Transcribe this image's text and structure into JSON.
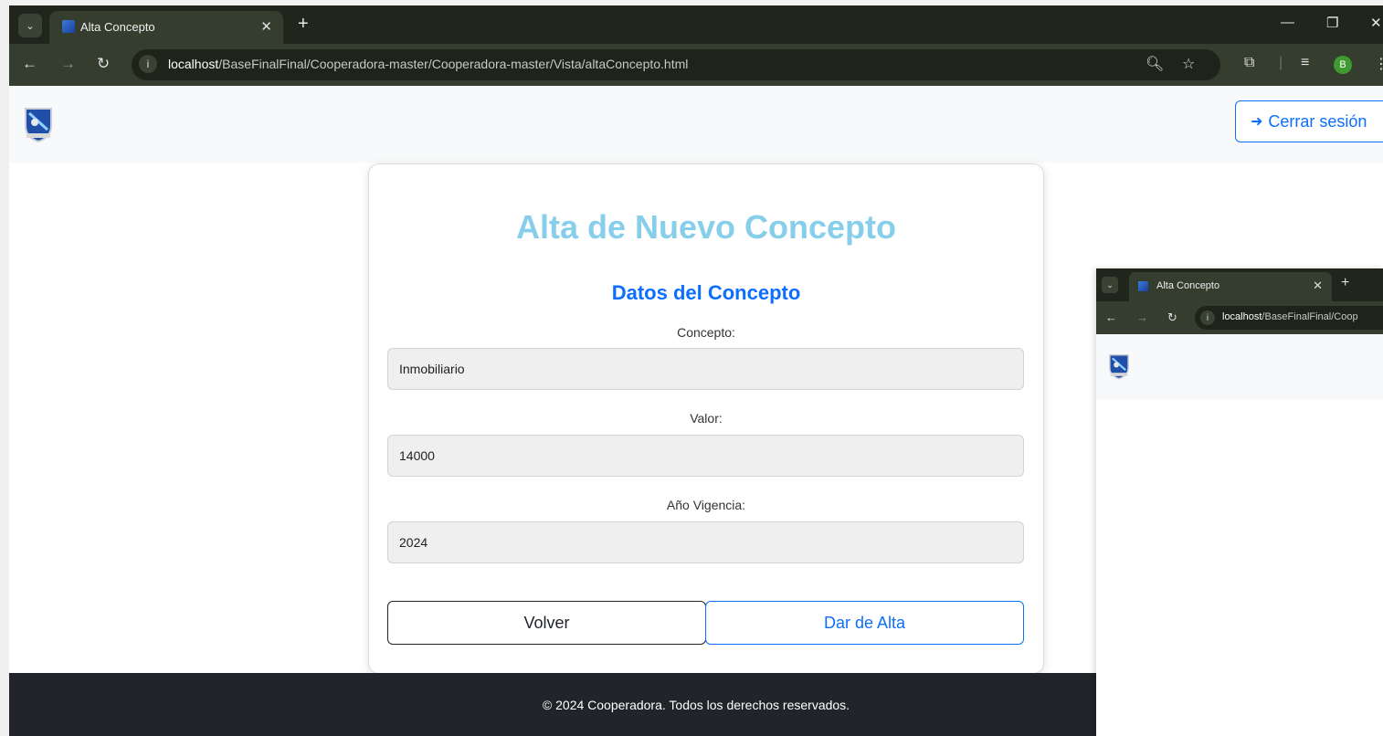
{
  "browser": {
    "tab_title": "Alta Concepto",
    "url_host": "localhost",
    "url_path": "/BaseFinalFinal/Cooperadora-master/Cooperadora-master/Vista/altaConcepto.html",
    "profile_initial": "B"
  },
  "navbar": {
    "logout_label": "Cerrar sesión"
  },
  "form": {
    "title": "Alta de Nuevo Concepto",
    "section_title": "Datos del Concepto",
    "concepto_label": "Concepto:",
    "concepto_value": "Inmobiliario",
    "valor_label": "Valor:",
    "valor_value": "14000",
    "anio_label": "Año Vigencia:",
    "anio_value": "2024",
    "back_label": "Volver",
    "submit_label": "Dar de Alta"
  },
  "footer": {
    "text": "© 2024 Cooperadora. Todos los derechos reservados."
  },
  "thumbnail": {
    "tab_title": "Alta Concepto",
    "url_host": "localhost",
    "url_path": "/BaseFinalFinal/Coop"
  },
  "colors": {
    "title": "#87ceeb",
    "primary": "#0d6efd",
    "footer_bg": "#212529",
    "browser_frame": "#353d2f"
  }
}
